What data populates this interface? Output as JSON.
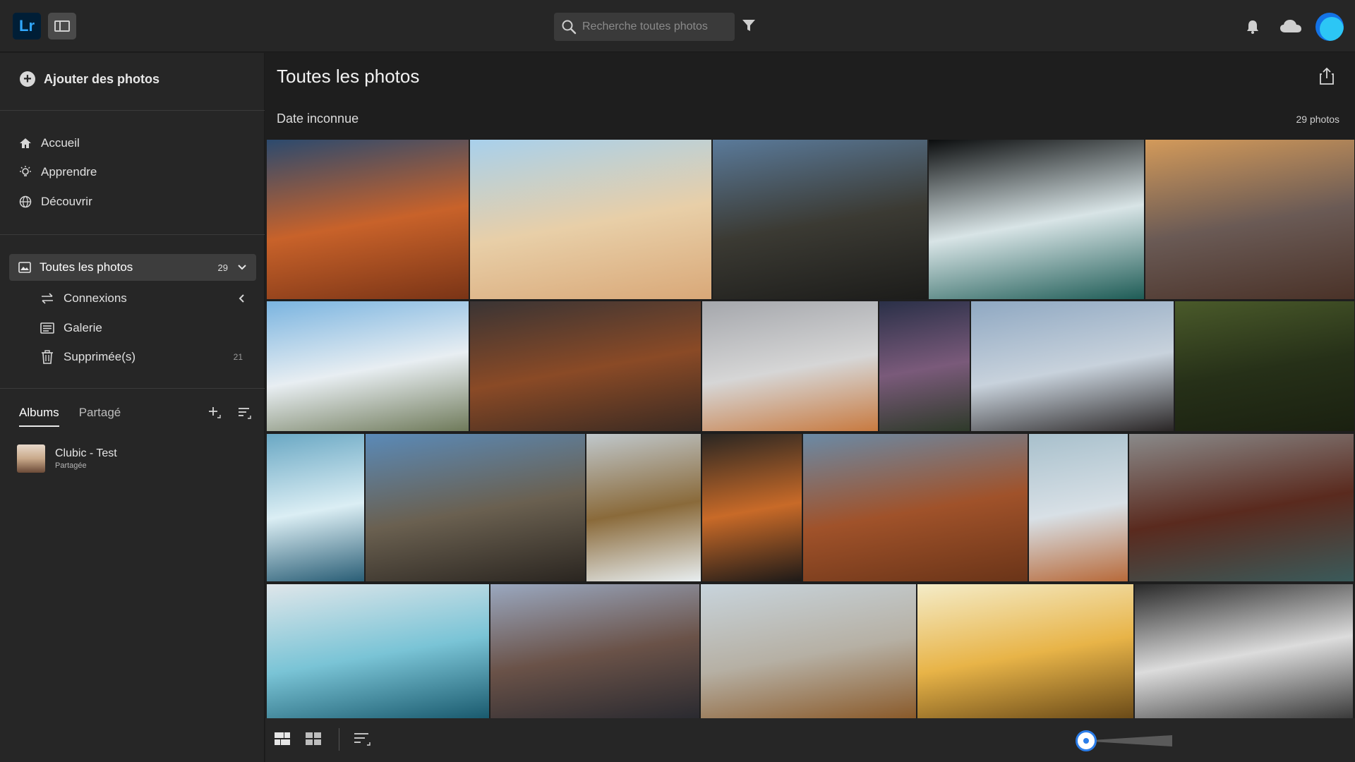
{
  "app": {
    "logo": "Lr"
  },
  "topbar": {
    "search_placeholder": "Recherche toutes photos",
    "icons": [
      "panel-toggle-icon",
      "search-icon",
      "filter-icon",
      "bell-icon",
      "cloud-icon",
      "avatar"
    ]
  },
  "sidebar": {
    "add_photos": "Ajouter des photos",
    "nav": [
      {
        "label": "Accueil",
        "icon": "home-icon"
      },
      {
        "label": "Apprendre",
        "icon": "lightbulb-icon"
      },
      {
        "label": "Découvrir",
        "icon": "globe-icon"
      }
    ],
    "all_photos": {
      "label": "Toutes les photos",
      "count": "29"
    },
    "sub_items": [
      {
        "label": "Connexions",
        "icon": "connections-icon"
      },
      {
        "label": "Galerie",
        "icon": "gallery-icon"
      },
      {
        "label": "Supprimée(s)",
        "icon": "trash-icon",
        "count": "21"
      }
    ],
    "tabs": [
      {
        "label": "Albums",
        "active": true
      },
      {
        "label": "Partagé",
        "active": false
      }
    ],
    "albums": [
      {
        "name": "Clubic - Test",
        "status": "Partagée"
      }
    ]
  },
  "main": {
    "title": "Toutes les photos",
    "date_heading": "Date inconnue",
    "photo_count": "29 photos",
    "photos": [
      {
        "id": "canyon-swirls",
        "colors": [
          "#2c4a6e",
          "#c8622a",
          "#7a3416"
        ]
      },
      {
        "id": "desert-dunes",
        "colors": [
          "#a8d0ec",
          "#e8cfa8",
          "#d9a878"
        ]
      },
      {
        "id": "waterfall-cliffs",
        "colors": [
          "#5a7a9a",
          "#3b3a33",
          "#1c1c1a"
        ]
      },
      {
        "id": "aerial-coast",
        "colors": [
          "#0b0d0e",
          "#d8e4e6",
          "#1e5c56"
        ]
      },
      {
        "id": "grand-canyon",
        "colors": [
          "#d39a5a",
          "#6a5a55",
          "#4a3228"
        ]
      },
      {
        "id": "snowy-mountain",
        "colors": [
          "#7ab4e0",
          "#e8eef2",
          "#6f7a5a"
        ]
      },
      {
        "id": "red-canyon-storm",
        "colors": [
          "#3a3434",
          "#8a4a26",
          "#3a2a22"
        ]
      },
      {
        "id": "aerial-river",
        "colors": [
          "#a5a7ac",
          "#d6d6d6",
          "#c87a40"
        ]
      },
      {
        "id": "rock-pinnacles",
        "colors": [
          "#2a3048",
          "#7a5a7a",
          "#2e3a2a"
        ]
      },
      {
        "id": "lone-figure",
        "colors": [
          "#8fa8c2",
          "#c8d2dc",
          "#2a2626"
        ]
      },
      {
        "id": "green-ridges",
        "colors": [
          "#4a5a2a",
          "#263018",
          "#1a2010"
        ]
      },
      {
        "id": "misty-falls",
        "colors": [
          "#6aa8c4",
          "#dbeef4",
          "#2a5e76"
        ]
      },
      {
        "id": "basalt-cliff",
        "colors": [
          "#5a8ab8",
          "#6a6050",
          "#2a2520"
        ]
      },
      {
        "id": "winter-falls",
        "colors": [
          "#c0c8cc",
          "#8a6a3a",
          "#e8eef0"
        ]
      },
      {
        "id": "firefall",
        "colors": [
          "#2a2622",
          "#c86a28",
          "#1e1a18"
        ]
      },
      {
        "id": "red-valley",
        "colors": [
          "#6a8aa6",
          "#a0522a",
          "#6a3418"
        ]
      },
      {
        "id": "desert-peaks",
        "colors": [
          "#a8c0cc",
          "#d8e0e6",
          "#b86a3a"
        ]
      },
      {
        "id": "fjord-mountains",
        "colors": [
          "#8a8a8a",
          "#5a2a1e",
          "#3a5a5a"
        ]
      },
      {
        "id": "frozen-falls",
        "colors": [
          "#dfe6ea",
          "#7ac4d6",
          "#1a5a6e"
        ]
      },
      {
        "id": "tre-cime",
        "colors": [
          "#9aa8c0",
          "#6a5248",
          "#2a2a30"
        ]
      },
      {
        "id": "cloudy-range",
        "colors": [
          "#c8d4dc",
          "#b6b0a4",
          "#8a5a2a"
        ]
      },
      {
        "id": "golden-sunrise",
        "colors": [
          "#f4ecc8",
          "#e8b448",
          "#6a4a18"
        ]
      },
      {
        "id": "dark-falls",
        "colors": [
          "#2a2a2a",
          "#dcdcdc",
          "#3a3a3a"
        ]
      }
    ]
  },
  "bottombar": {
    "icons": [
      "photo-grid-icon",
      "square-grid-icon",
      "sort-icon"
    ],
    "zoom_level": 0.1
  }
}
